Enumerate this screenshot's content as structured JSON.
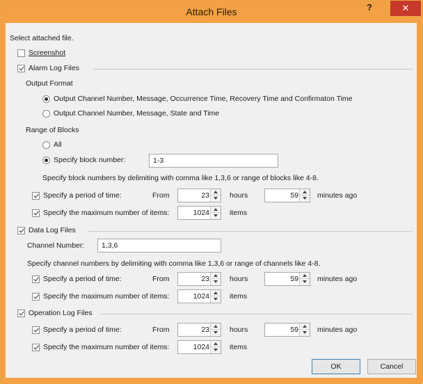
{
  "window": {
    "title": "Attach Files",
    "help_label": "?",
    "close_label": "✕"
  },
  "select_label": "Select attached file.",
  "screenshot": {
    "label": "Screenshot",
    "checked": false
  },
  "alarm": {
    "label": "Alarm Log Files",
    "checked": true,
    "output_format_label": "Output Format",
    "format_option1": "Output Channel Number, Message, Occurrence Time, Recovery Time and Confirmaton Time",
    "format_option2": "Output Channel Number, Message, State and Time",
    "range_label": "Range of Blocks",
    "all_label": "All",
    "specify_block_label": "Specify block number:",
    "block_value": "1-3",
    "block_hint": "Specify block numbers by delimiting with comma like 1,3,6 or range of blocks like 4-8.",
    "period_label": "Specify a period of time:",
    "from_label": "From",
    "hours_value": "23",
    "hours_label": "hours",
    "minutes_value": "59",
    "minutes_label": "minutes ago",
    "max_items_label": "Specify the maximum number of items:",
    "items_value": "1024",
    "items_label": "items"
  },
  "data": {
    "label": "Data Log Files",
    "checked": true,
    "channel_label": "Channel Number:",
    "channel_value": "1,3,6",
    "channel_hint": "Specify channel numbers by delimiting with comma like 1,3,6 or range of channels like 4-8.",
    "period_label": "Specify a period of time:",
    "from_label": "From",
    "hours_value": "23",
    "hours_label": "hours",
    "minutes_value": "59",
    "minutes_label": "minutes ago",
    "max_items_label": "Specify the maximum number of items:",
    "items_value": "1024",
    "items_label": "items"
  },
  "operation": {
    "label": "Operation Log Files",
    "checked": true,
    "period_label": "Specify a period of time:",
    "from_label": "From",
    "hours_value": "23",
    "hours_label": "hours",
    "minutes_value": "59",
    "minutes_label": "minutes ago",
    "max_items_label": "Specify the maximum number of items:",
    "items_value": "1024",
    "items_label": "items"
  },
  "buttons": {
    "ok": "OK",
    "cancel": "Cancel"
  },
  "colors": {
    "title_bar": "#f3a144",
    "close_button": "#c7392b",
    "dialog_bg": "#f0f0f0"
  }
}
